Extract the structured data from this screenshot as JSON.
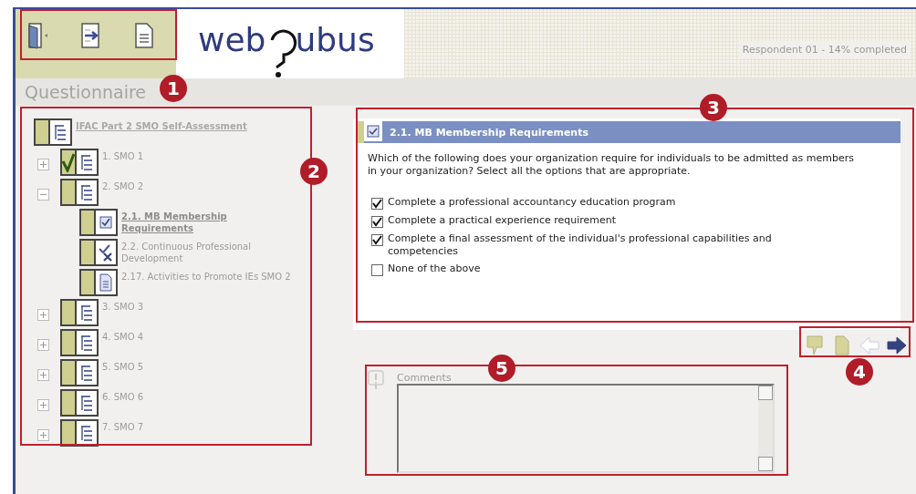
{
  "toolbar": [
    {
      "kind": "exit"
    },
    {
      "kind": "import"
    },
    {
      "kind": "document"
    }
  ],
  "logo": {
    "left": "web",
    "right": "ubus"
  },
  "status": "Respondent 01 - 14% completed",
  "section_title": "Questionnaire",
  "tree": {
    "label": "IFAC Part 2 SMO Self-Assessment",
    "kind": "section",
    "selected": false,
    "completed": false,
    "children": [
      {
        "label": "1. SMO 1",
        "kind": "section",
        "selected": false,
        "completed": true,
        "expanded": false
      },
      {
        "label": "2. SMO 2",
        "kind": "section",
        "selected": false,
        "completed": false,
        "expanded": true,
        "children": [
          {
            "label": "2.1. MB Membership Requirements",
            "kind": "question",
            "selected": true,
            "completed": false
          },
          {
            "label": "2.2. Continuous Professional Development",
            "kind": "mixed",
            "selected": false,
            "completed": false
          },
          {
            "label": "2.17. Activities to Promote IEs SMO 2",
            "kind": "document",
            "selected": false,
            "completed": false
          }
        ]
      },
      {
        "label": "3. SMO 3",
        "kind": "section",
        "selected": false,
        "completed": false,
        "expanded": false
      },
      {
        "label": "4. SMO 4",
        "kind": "section",
        "selected": false,
        "completed": false,
        "expanded": false
      },
      {
        "label": "5. SMO 5",
        "kind": "section",
        "selected": false,
        "completed": false,
        "expanded": false
      },
      {
        "label": "6. SMO 6",
        "kind": "section",
        "selected": false,
        "completed": false,
        "expanded": false
      },
      {
        "label": "7. SMO 7",
        "kind": "section",
        "selected": false,
        "completed": false,
        "expanded": false
      }
    ]
  },
  "question": {
    "title": "2.1. MB Membership Requirements",
    "text": "Which of the following does your organization require for individuals to be admitted as members in your organization? Select all the options that are appropriate.",
    "options": [
      {
        "label": "Complete a professional accountancy education program",
        "checked": true
      },
      {
        "label": "Complete a practical experience requirement",
        "checked": true
      },
      {
        "label": "Complete a final assessment of the individual's professional capabilities and competencies",
        "checked": true
      },
      {
        "label": "None of the above",
        "checked": false
      }
    ]
  },
  "nav": [
    {
      "kind": "comment",
      "disabled": false
    },
    {
      "kind": "document",
      "disabled": false
    },
    {
      "kind": "back",
      "disabled": true
    },
    {
      "kind": "next",
      "disabled": false
    }
  ],
  "comments": {
    "label": "Comments"
  },
  "callouts": [
    "1",
    "2",
    "3",
    "4",
    "5"
  ]
}
